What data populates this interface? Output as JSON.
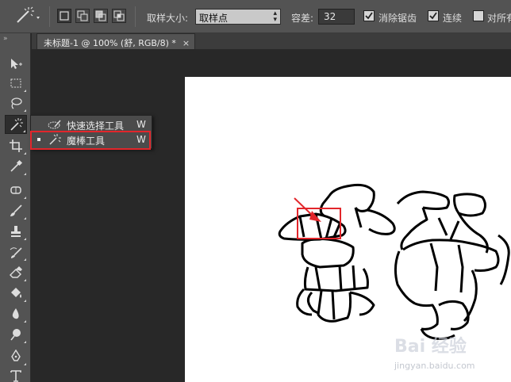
{
  "options_bar": {
    "sample_size_label": "取样大小:",
    "sample_size_value": "取样点",
    "tolerance_label": "容差:",
    "tolerance_value": "32",
    "antialias_label": "消除锯齿",
    "contiguous_label": "连续",
    "all_layers_label": "对所有"
  },
  "document_tab": {
    "title": "未标题-1 @ 100% (舒, RGB/8) *",
    "close_glyph": "×"
  },
  "flyout": {
    "items": [
      {
        "label": "快速选择工具",
        "shortcut": "W",
        "icon": "quick-selection-icon"
      },
      {
        "label": "魔棒工具",
        "shortcut": "W",
        "icon": "magic-wand-icon"
      }
    ]
  },
  "watermark": {
    "brand": "Bai 经验",
    "url": "jingyan.baidu.com"
  },
  "colors": {
    "highlight": "#e2262b",
    "panel": "#535353",
    "workspace": "#282828",
    "canvas": "#ffffff"
  }
}
